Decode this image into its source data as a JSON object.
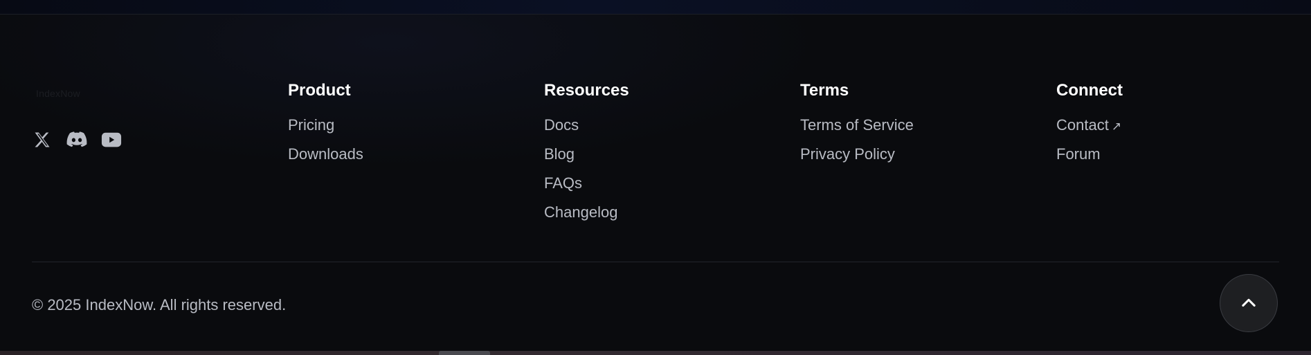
{
  "brand": {
    "logo_text": "IndexNow"
  },
  "socials": [
    {
      "icon": "x-twitter-icon"
    },
    {
      "icon": "discord-icon"
    },
    {
      "icon": "youtube-icon"
    }
  ],
  "columns": {
    "product": {
      "title": "Product",
      "links": [
        "Pricing",
        "Downloads"
      ]
    },
    "resources": {
      "title": "Resources",
      "links": [
        "Docs",
        "Blog",
        "FAQs",
        "Changelog"
      ]
    },
    "terms": {
      "title": "Terms",
      "links": [
        "Terms of Service",
        "Privacy Policy"
      ]
    },
    "connect": {
      "title": "Connect",
      "links": [
        "Contact",
        "Forum"
      ],
      "contact_arrow": "↗"
    }
  },
  "copyright": "© 2025 IndexNow. All rights reserved.",
  "colors": {
    "background": "#0a0b0e",
    "heading": "#ffffff",
    "link": "#b9bcc4"
  }
}
